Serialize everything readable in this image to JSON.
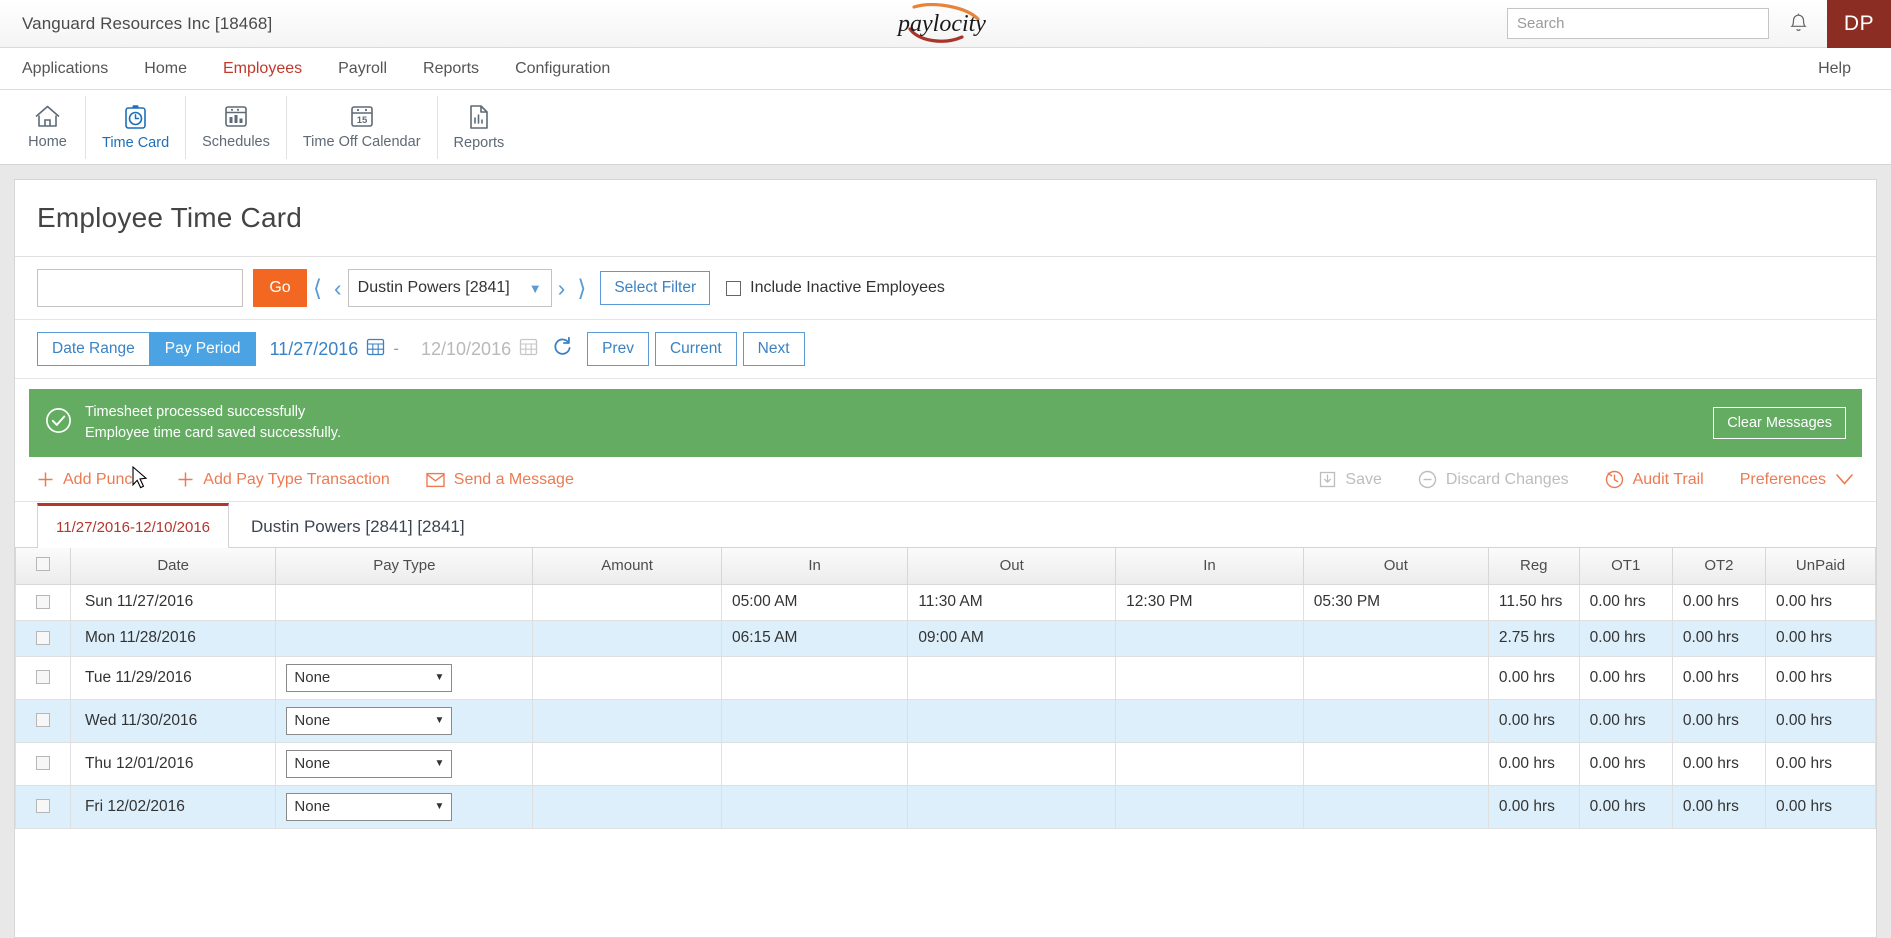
{
  "topbar": {
    "company": "Vanguard Resources Inc [18468]",
    "logo_text": "paylocity",
    "search_placeholder": "Search",
    "search_value": "",
    "avatar_initials": "DP",
    "bell_icon": "notification-bell-icon"
  },
  "mainnav": {
    "items": [
      {
        "label": "Applications",
        "active": false
      },
      {
        "label": "Home",
        "active": false
      },
      {
        "label": "Employees",
        "active": true
      },
      {
        "label": "Payroll",
        "active": false
      },
      {
        "label": "Reports",
        "active": false
      },
      {
        "label": "Configuration",
        "active": false
      }
    ],
    "help": "Help"
  },
  "icontoolbar": {
    "items": [
      {
        "label": "Home",
        "icon": "home-icon",
        "active": false
      },
      {
        "label": "Time Card",
        "icon": "stopwatch-clipboard-icon",
        "active": true
      },
      {
        "label": "Schedules",
        "icon": "schedule-grid-icon",
        "active": false
      },
      {
        "label": "Time Off Calendar",
        "icon": "calendar-15-icon",
        "active": false
      },
      {
        "label": "Reports",
        "icon": "report-document-icon",
        "active": false
      }
    ]
  },
  "page": {
    "title": "Employee Time Card"
  },
  "employee_row": {
    "search_value": "",
    "search_placeholder": "",
    "go_label": "Go",
    "first_icon": "first-page-icon",
    "prev_icon": "previous-icon",
    "next_icon": "next-icon",
    "last_icon": "last-page-icon",
    "selected_employee": "Dustin Powers [2841]",
    "select_filter_label": "Select Filter",
    "include_inactive_label": "Include Inactive Employees",
    "include_inactive_checked": false
  },
  "date_row": {
    "date_range_label": "Date Range",
    "pay_period_label": "Pay Period",
    "pay_period_active": true,
    "date_range_active": false,
    "start_date": "11/27/2016",
    "end_date": "12/10/2016",
    "separator": "-",
    "refresh_icon": "refresh-icon",
    "calendar_icon": "calendar-icon",
    "prev_label": "Prev",
    "current_label": "Current",
    "next_label": "Next"
  },
  "banner": {
    "icon": "check-circle-icon",
    "line1": "Timesheet processed successfully",
    "line2": "Employee time card saved successfully.",
    "clear_label": "Clear Messages",
    "color": "#63ac62"
  },
  "actions": {
    "left": [
      {
        "label": "Add Punch",
        "icon": "plus-icon",
        "disabled": false
      },
      {
        "label": "Add Pay Type Transaction",
        "icon": "plus-icon",
        "disabled": false
      },
      {
        "label": "Send a Message",
        "icon": "envelope-icon",
        "disabled": false
      }
    ],
    "right": [
      {
        "label": "Save",
        "icon": "save-download-icon",
        "disabled": true
      },
      {
        "label": "Discard Changes",
        "icon": "minus-circle-icon",
        "disabled": true
      },
      {
        "label": "Audit Trail",
        "icon": "audit-clock-icon",
        "disabled": false
      },
      {
        "label": "Preferences",
        "icon": "chevron-down-icon",
        "disabled": false
      }
    ]
  },
  "tabs": {
    "period_tab": "11/27/2016-12/10/2016",
    "employee_label": "Dustin Powers [2841] [2841]"
  },
  "table": {
    "columns": [
      "",
      "Date",
      "Pay Type",
      "Amount",
      "In",
      "Out",
      "In",
      "Out",
      "Reg",
      "OT1",
      "OT2",
      "UnPaid"
    ],
    "rows": [
      {
        "checked": false,
        "date": "Sun 11/27/2016",
        "pay_type": "",
        "has_select": false,
        "amount": "",
        "in1": "05:00 AM",
        "out1": "11:30 AM",
        "in2": "12:30 PM",
        "out2": "05:30 PM",
        "reg": "11.50 hrs",
        "ot1": "0.00 hrs",
        "ot2": "0.00 hrs",
        "unpaid": "0.00 hrs",
        "alt": false
      },
      {
        "checked": false,
        "date": "Mon 11/28/2016",
        "pay_type": "",
        "has_select": false,
        "amount": "",
        "in1": "06:15 AM",
        "out1": "09:00 AM",
        "in2": "",
        "out2": "",
        "reg": "2.75 hrs",
        "ot1": "0.00 hrs",
        "ot2": "0.00 hrs",
        "unpaid": "0.00 hrs",
        "alt": true
      },
      {
        "checked": false,
        "date": "Tue 11/29/2016",
        "pay_type": "None",
        "has_select": true,
        "amount": "",
        "in1": "",
        "out1": "",
        "in2": "",
        "out2": "",
        "reg": "0.00 hrs",
        "ot1": "0.00 hrs",
        "ot2": "0.00 hrs",
        "unpaid": "0.00 hrs",
        "alt": false
      },
      {
        "checked": false,
        "date": "Wed 11/30/2016",
        "pay_type": "None",
        "has_select": true,
        "amount": "",
        "in1": "",
        "out1": "",
        "in2": "",
        "out2": "",
        "reg": "0.00 hrs",
        "ot1": "0.00 hrs",
        "ot2": "0.00 hrs",
        "unpaid": "0.00 hrs",
        "alt": true
      },
      {
        "checked": false,
        "date": "Thu 12/01/2016",
        "pay_type": "None",
        "has_select": true,
        "amount": "",
        "in1": "",
        "out1": "",
        "in2": "",
        "out2": "",
        "reg": "0.00 hrs",
        "ot1": "0.00 hrs",
        "ot2": "0.00 hrs",
        "unpaid": "0.00 hrs",
        "alt": false
      },
      {
        "checked": false,
        "date": "Fri 12/02/2016",
        "pay_type": "None",
        "has_select": true,
        "amount": "",
        "in1": "",
        "out1": "",
        "in2": "",
        "out2": "",
        "reg": "0.00 hrs",
        "ot1": "0.00 hrs",
        "ot2": "0.00 hrs",
        "unpaid": "0.00 hrs",
        "alt": true
      }
    ]
  }
}
